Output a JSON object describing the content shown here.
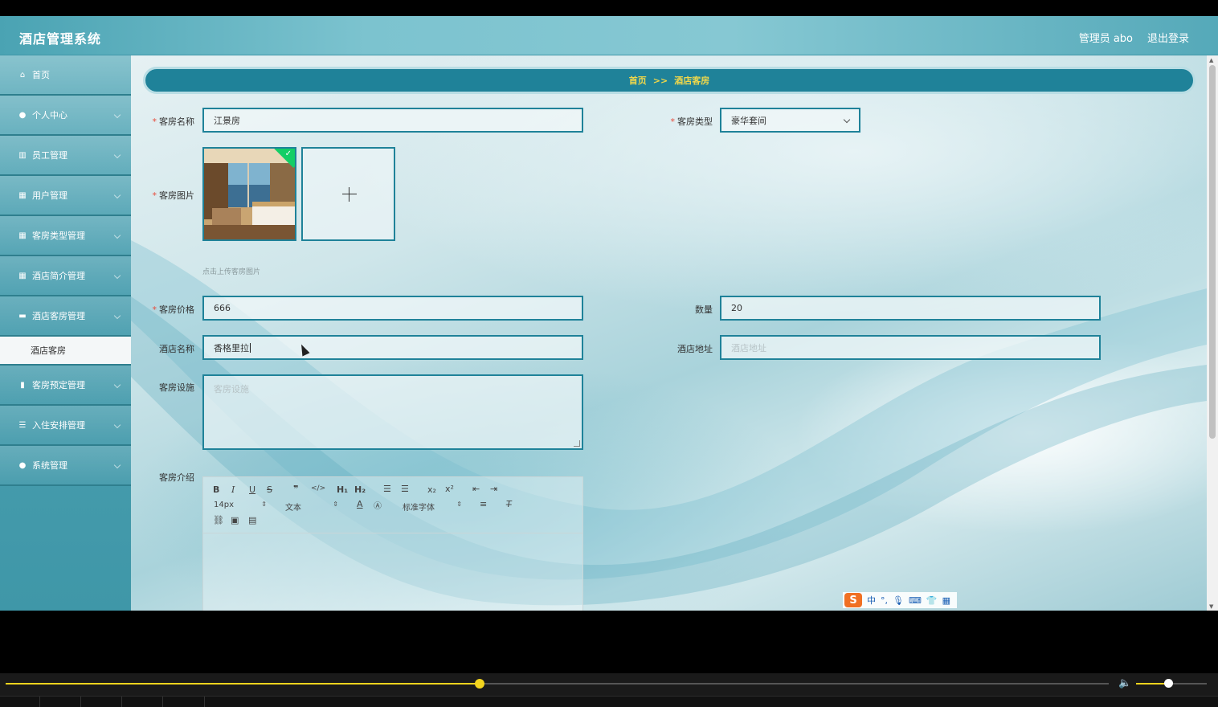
{
  "header": {
    "title": "酒店管理系统",
    "user": "管理员 abo",
    "logout": "退出登录"
  },
  "sidebar": {
    "items": [
      {
        "label": "首页",
        "icon": "home-icon"
      },
      {
        "label": "个人中心",
        "icon": "user-icon"
      },
      {
        "label": "员工管理",
        "icon": "bar-icon"
      },
      {
        "label": "用户管理",
        "icon": "grid-icon"
      },
      {
        "label": "客房类型管理",
        "icon": "grid-icon"
      },
      {
        "label": "酒店简介管理",
        "icon": "grid-icon"
      },
      {
        "label": "酒店客房管理",
        "icon": "chat-icon"
      },
      {
        "label": "客房预定管理",
        "icon": "chart-icon"
      },
      {
        "label": "入住安排管理",
        "icon": "sliders-icon"
      },
      {
        "label": "系统管理",
        "icon": "user-icon"
      }
    ],
    "active_sub": "酒店客房"
  },
  "breadcrumb": {
    "home": "首页",
    "sep": ">>",
    "current": "酒店客房"
  },
  "form": {
    "room_name": {
      "label": "客房名称",
      "value": "江景房"
    },
    "room_type": {
      "label": "客房类型",
      "value": "豪华套间"
    },
    "room_image": {
      "label": "客房图片",
      "tip": "点击上传客房图片"
    },
    "price": {
      "label": "客房价格",
      "value": "666"
    },
    "quantity": {
      "label": "数量",
      "value": "20"
    },
    "hotel_name": {
      "label": "酒店名称",
      "value": "香格里拉"
    },
    "hotel_address": {
      "label": "酒店地址",
      "placeholder": "酒店地址"
    },
    "facilities": {
      "label": "客房设施",
      "placeholder": "客房设施"
    },
    "intro": {
      "label": "客房介绍"
    }
  },
  "editor": {
    "font_size": "14px",
    "header_select": "文本",
    "font_family": "标准字体"
  },
  "ime": {
    "mode": "中"
  },
  "player": {
    "progress": 0.43,
    "volume": 0.45
  },
  "colors": {
    "accent": "#1f8299",
    "breadcrumb_text": "#f0d84a",
    "progress": "#f3d41e"
  }
}
